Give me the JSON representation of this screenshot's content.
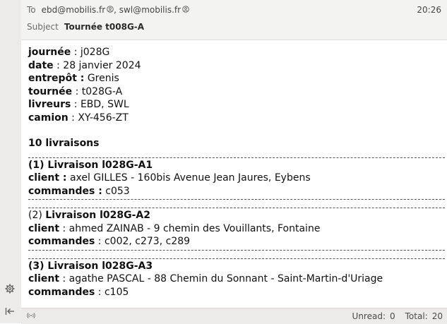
{
  "header": {
    "to_label": "To",
    "recipients": [
      "ebd@mobilis.fr",
      "swl@mobilis.fr"
    ],
    "separator": ",",
    "subject_label": "Subject",
    "subject": "Tournée t008G-A",
    "time": "20:26"
  },
  "body": {
    "info": [
      {
        "key": "journée",
        "sep": " : ",
        "value": "j028G"
      },
      {
        "key": "date",
        "sep": " : ",
        "value": "28 janvier 2024"
      },
      {
        "key": "entrepôt :",
        "sep": " ",
        "value": "Grenis"
      },
      {
        "key": "tournée",
        "sep": " : ",
        "value": "t028G-A"
      },
      {
        "key": "livreurs",
        "sep": " : ",
        "value": "EBD, SWL"
      },
      {
        "key": "camion",
        "sep": " : ",
        "value": "XY-456-ZT"
      }
    ],
    "summary": "10 livraisons",
    "deliveries": [
      {
        "title": "(1) Livraison l028G-A1",
        "client_key": "client :",
        "client_value": " axel GILLES -  160bis Avenue Jean Jaures, Eybens",
        "orders_key": "commandes :",
        "orders_value": " c053"
      },
      {
        "title_prefix": "(2) ",
        "title": "Livraison l028G-A2",
        "client_key": "client",
        "client_value": " : ahmed ZAINAB - 9 chemin des Vouillants, Fontaine",
        "orders_key": "commandes",
        "orders_value": " : c002, c273, c289"
      },
      {
        "title": "(3) Livraison l028G-A3",
        "client_key": "client",
        "client_value": " : agathe PASCAL - 88 Chemin du Sonnant - Saint-Martin-d'Uriage",
        "orders_key": "commandes",
        "orders_value": " : c105"
      }
    ]
  },
  "status": {
    "unread_label": "Unread:",
    "unread_count": "0",
    "total_label": "Total:",
    "total_count": "20"
  },
  "icons": {
    "settings": "gear-icon",
    "collapse": "collapse-pane-icon",
    "online": "wireless-icon",
    "address_card": "contact-card-icon"
  }
}
